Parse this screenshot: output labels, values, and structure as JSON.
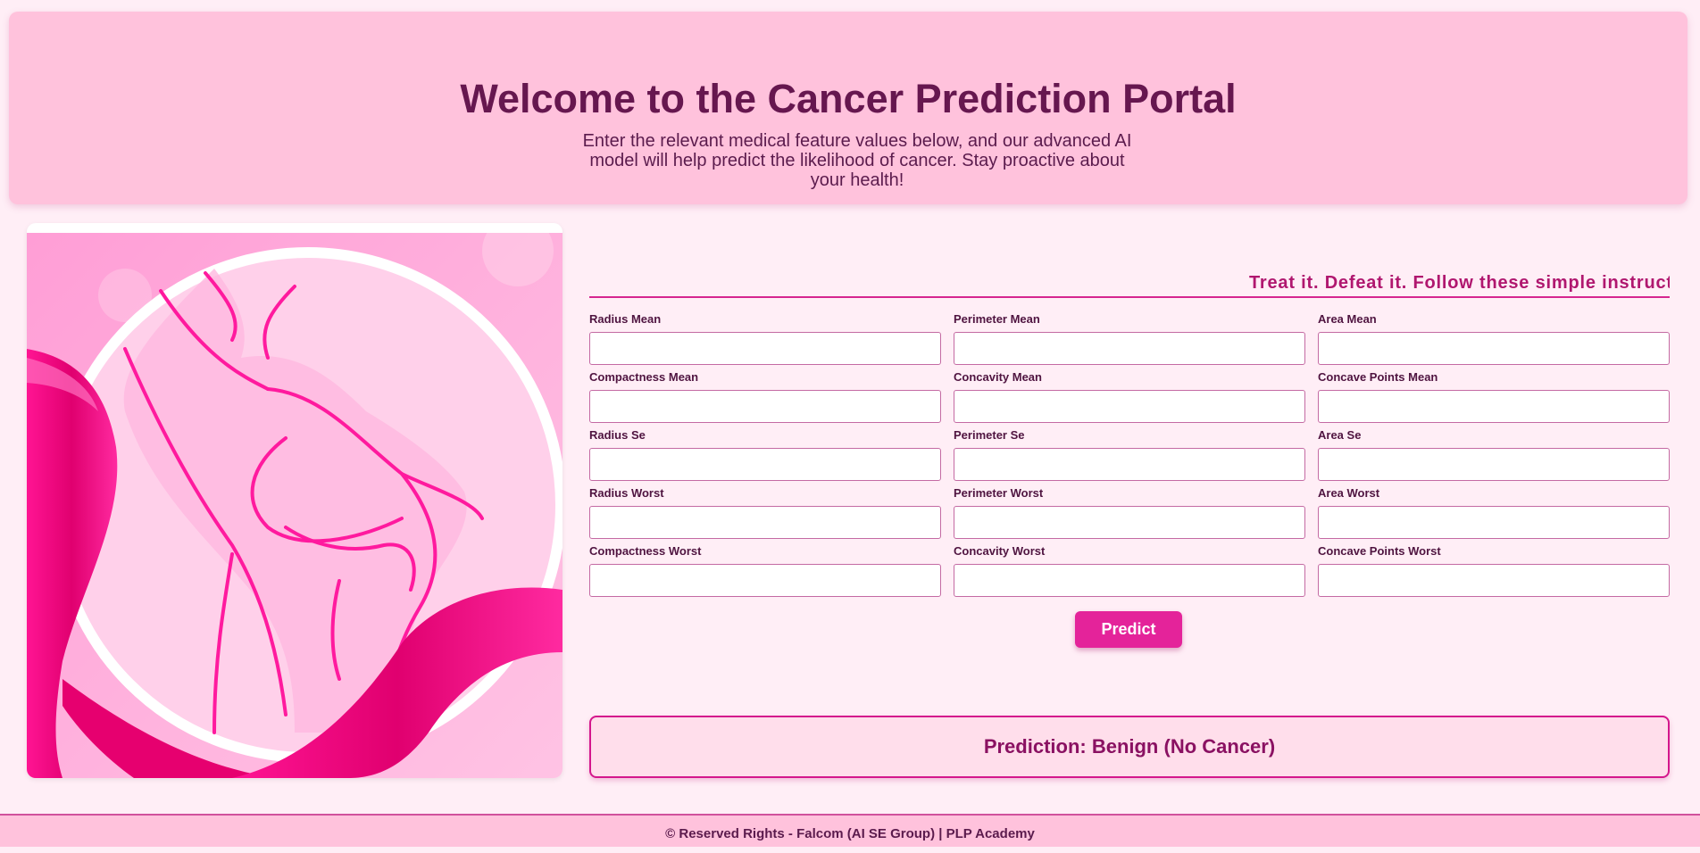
{
  "header": {
    "title": "Welcome to the Cancer Prediction Portal",
    "subtitle": "Enter the relevant medical feature values below, and our advanced AI model will help predict the likelihood of cancer. Stay proactive about your health!"
  },
  "illustration": {
    "icon": "pink-ribbon-illustration"
  },
  "form": {
    "tagline": "Treat it. Defeat it. Follow these simple instructions",
    "fields": [
      {
        "label": "Radius Mean",
        "value": ""
      },
      {
        "label": "Perimeter Mean",
        "value": ""
      },
      {
        "label": "Area Mean",
        "value": ""
      },
      {
        "label": "Compactness Mean",
        "value": ""
      },
      {
        "label": "Concavity Mean",
        "value": ""
      },
      {
        "label": "Concave Points Mean",
        "value": ""
      },
      {
        "label": "Radius Se",
        "value": ""
      },
      {
        "label": "Perimeter Se",
        "value": ""
      },
      {
        "label": "Area Se",
        "value": ""
      },
      {
        "label": "Radius Worst",
        "value": ""
      },
      {
        "label": "Perimeter Worst",
        "value": ""
      },
      {
        "label": "Area Worst",
        "value": ""
      },
      {
        "label": "Compactness Worst",
        "value": ""
      },
      {
        "label": "Concavity Worst",
        "value": ""
      },
      {
        "label": "Concave Points Worst",
        "value": ""
      }
    ],
    "predict_label": "Predict"
  },
  "result": {
    "text": "Prediction: Benign (No Cancer)"
  },
  "footer": {
    "text": "© Reserved Rights - Falcom (AI SE Group) | PLP Academy"
  },
  "colors": {
    "accent": "#e4239a",
    "header_bg": "#ffc2dc",
    "page_bg": "#ffeef6",
    "title": "#66174f"
  }
}
